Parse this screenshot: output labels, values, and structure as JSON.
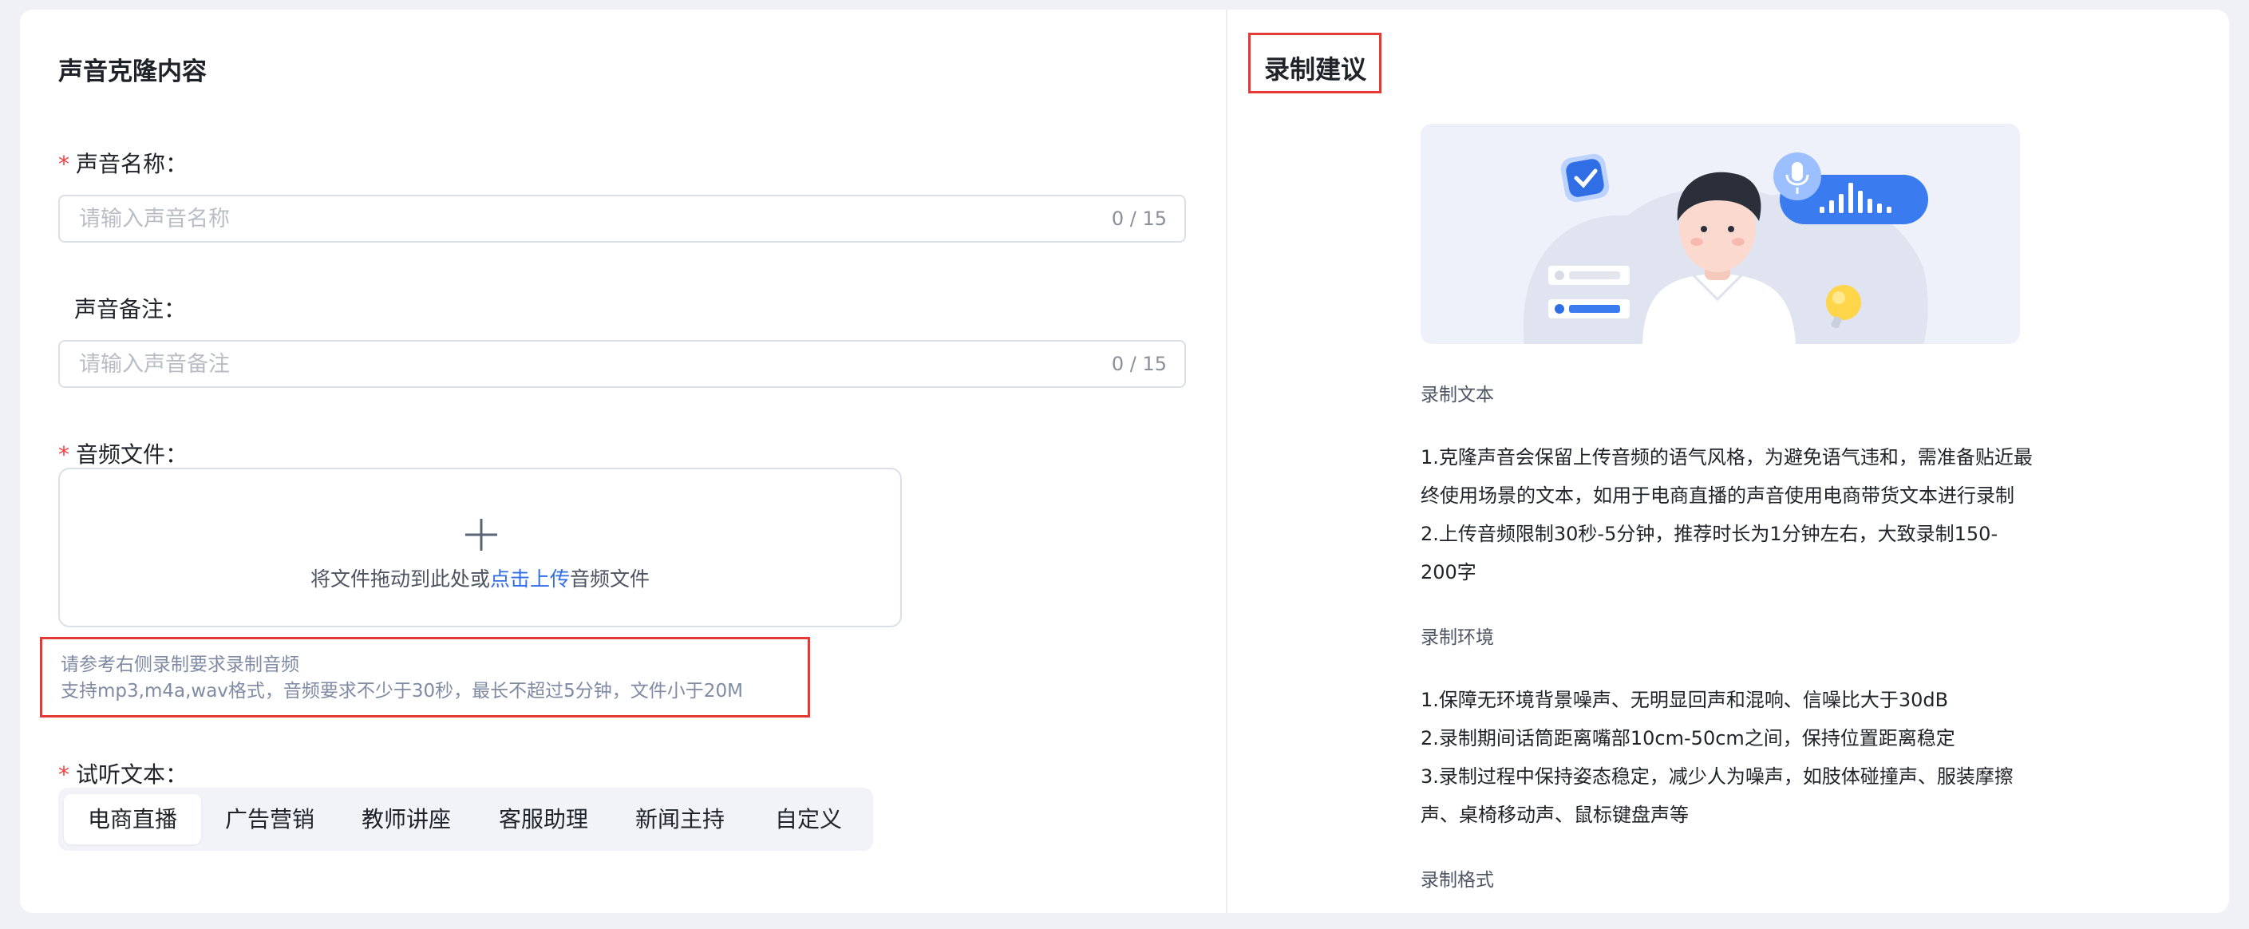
{
  "left": {
    "section_title": "声音克隆内容",
    "voice_name": {
      "label": "声音名称：",
      "placeholder": "请输入声音名称",
      "counter": "0 / 15"
    },
    "voice_note": {
      "label": "声音备注：",
      "placeholder": "请输入声音备注",
      "counter": "0 / 15"
    },
    "audio_file": {
      "label": "音频文件：",
      "upload_prefix": "将文件拖动到此处或",
      "upload_link": "点击上传",
      "upload_suffix": "音频文件"
    },
    "hint": {
      "line1": "请参考右侧录制要求录制音频",
      "line2": "支持mp3,m4a,wav格式，音频要求不少于30秒，最长不超过5分钟，文件小于20M"
    },
    "preview_text": {
      "label": "试听文本：",
      "tabs": [
        "电商直播",
        "广告营销",
        "教师讲座",
        "客服助理",
        "新闻主持",
        "自定义"
      ],
      "active_index": 0
    },
    "required_mark": "*"
  },
  "right": {
    "title": "录制建议",
    "sections": [
      {
        "heading": "录制文本",
        "lines": [
          "1.克隆声音会保留上传音频的语气风格，为避免语气违和，需准备贴近最",
          "终使用场景的文本，如用于电商直播的声音使用电商带货文本进行录制",
          "2.上传音频限制30秒-5分钟，推荐时长为1分钟左右，大致录制150-",
          "200字"
        ]
      },
      {
        "heading": "录制环境",
        "lines": [
          "1.保障无环境背景噪声、无明显回声和混响、信噪比大于30dB",
          "2.录制期间话筒距离嘴部10cm-50cm之间，保持位置距离稳定",
          "3.录制过程中保持姿态稳定，减少人为噪声，如肢体碰撞声、服装摩擦",
          "声、桌椅移动声、鼠标键盘声等"
        ]
      },
      {
        "heading": "录制格式",
        "lines": []
      }
    ]
  },
  "colors": {
    "accent": "#2f6ee5",
    "required": "#f53f3f",
    "highlight_border": "#e53935"
  }
}
